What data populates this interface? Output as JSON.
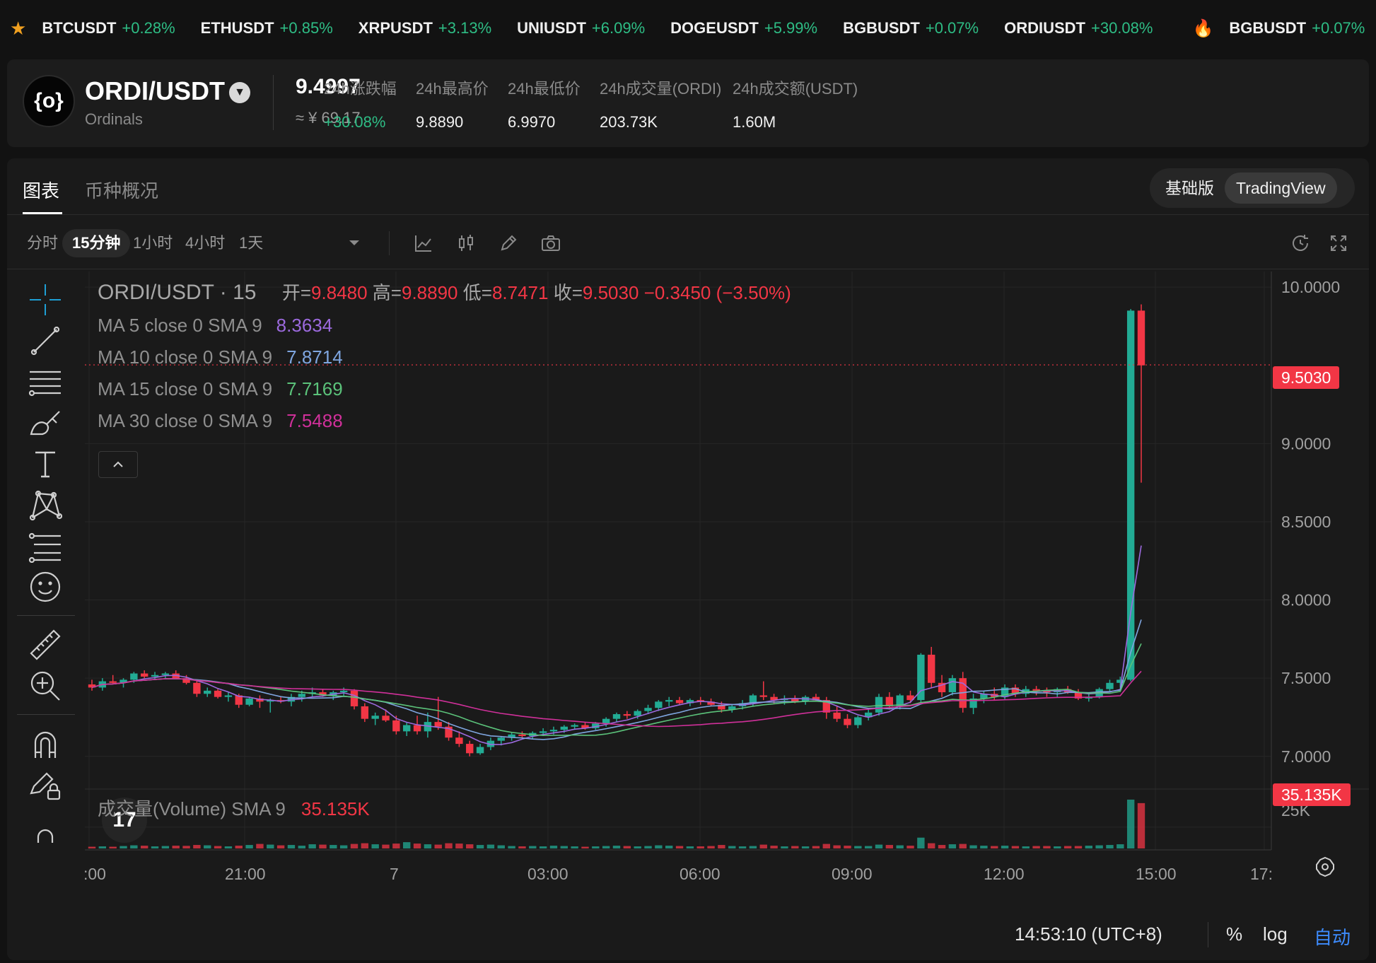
{
  "ticker": {
    "items": [
      {
        "symbol": "BTCUSDT",
        "change": "+0.28%"
      },
      {
        "symbol": "ETHUSDT",
        "change": "+0.85%"
      },
      {
        "symbol": "XRPUSDT",
        "change": "+3.13%"
      },
      {
        "symbol": "UNIUSDT",
        "change": "+6.09%"
      },
      {
        "symbol": "DOGEUSDT",
        "change": "+5.99%"
      },
      {
        "symbol": "BGBUSDT",
        "change": "+0.07%"
      },
      {
        "symbol": "ORDIUSDT",
        "change": "+30.08%"
      }
    ],
    "hot_item": {
      "symbol": "BGBUSDT",
      "change": "+0.07%"
    }
  },
  "header": {
    "logo_glyph": "{o}",
    "pair": "ORDI/USDT",
    "subtitle": "Ordinals",
    "price": "9.4997",
    "price_cny": "≈ ¥ 69.17",
    "stats": [
      {
        "label": "24h涨跌幅",
        "value": "+30.08%",
        "up": true
      },
      {
        "label": "24h最高价",
        "value": "9.8890",
        "up": false
      },
      {
        "label": "24h最低价",
        "value": "6.9970",
        "up": false
      },
      {
        "label": "24h成交量(ORDI)",
        "value": "203.73K",
        "up": false
      },
      {
        "label": "24h成交额(USDT)",
        "value": "1.60M",
        "up": false
      }
    ]
  },
  "tabs": {
    "chart": "图表",
    "overview": "币种概况",
    "basic": "基础版",
    "tradingview": "TradingView"
  },
  "toolbar": {
    "timeframes": [
      "分时",
      "15分钟",
      "1小时",
      "4小时",
      "1天"
    ],
    "selected_timeframe": "15分钟"
  },
  "legend": {
    "symbol": "ORDI/USDT · 15",
    "open_label": "开=",
    "open": "9.8480",
    "high_label": "高=",
    "high": "9.8890",
    "low_label": "低=",
    "low": "8.7471",
    "close_label": "收=",
    "close": "9.5030",
    "change": "−0.3450 (−3.50%)",
    "ma": [
      {
        "label": "MA 5 close 0 SMA 9",
        "value": "8.3634",
        "color": "#9c6ade"
      },
      {
        "label": "MA 10 close 0 SMA 9",
        "value": "7.8714",
        "color": "#7fa6e0"
      },
      {
        "label": "MA 15 close 0 SMA 9",
        "value": "7.7169",
        "color": "#5bc27a"
      },
      {
        "label": "MA 30 close 0 SMA 9",
        "value": "7.5488",
        "color": "#d0309a"
      }
    ],
    "volume_label": "成交量(Volume) SMA 9",
    "volume_value": "35.135K"
  },
  "chart_data": {
    "type": "candlestick",
    "price_axis": {
      "ticks": [
        "10.0000",
        "9.0000",
        "8.5000",
        "8.0000",
        "7.5000",
        "7.0000"
      ],
      "ylim": [
        6.8,
        10.1
      ]
    },
    "time_axis": {
      "ticks": [
        ":00",
        "21:00",
        "7",
        "03:00",
        "06:00",
        "09:00",
        "12:00",
        "15:00",
        "17:"
      ]
    },
    "last_price_label": "9.5030",
    "volume_axis": {
      "ticks": [
        "25K"
      ],
      "last_volume_label": "35.135K"
    },
    "colors": {
      "up": "#22ab94",
      "down": "#f23645",
      "grid": "#262626"
    },
    "candles": [
      [
        7.46,
        7.49,
        7.42,
        7.44
      ],
      [
        7.44,
        7.5,
        7.42,
        7.48
      ],
      [
        7.48,
        7.52,
        7.46,
        7.47
      ],
      [
        7.47,
        7.5,
        7.44,
        7.49
      ],
      [
        7.49,
        7.54,
        7.47,
        7.53
      ],
      [
        7.53,
        7.55,
        7.5,
        7.51
      ],
      [
        7.51,
        7.54,
        7.49,
        7.52
      ],
      [
        7.52,
        7.54,
        7.5,
        7.53
      ],
      [
        7.53,
        7.55,
        7.5,
        7.5
      ],
      [
        7.5,
        7.52,
        7.46,
        7.47
      ],
      [
        7.47,
        7.49,
        7.38,
        7.4
      ],
      [
        7.4,
        7.44,
        7.38,
        7.42
      ],
      [
        7.42,
        7.43,
        7.37,
        7.38
      ],
      [
        7.38,
        7.41,
        7.35,
        7.39
      ],
      [
        7.39,
        7.4,
        7.31,
        7.33
      ],
      [
        7.33,
        7.38,
        7.32,
        7.37
      ],
      [
        7.37,
        7.39,
        7.31,
        7.35
      ],
      [
        7.35,
        7.37,
        7.28,
        7.36
      ],
      [
        7.36,
        7.38,
        7.34,
        7.35
      ],
      [
        7.35,
        7.4,
        7.32,
        7.38
      ],
      [
        7.38,
        7.42,
        7.35,
        7.4
      ],
      [
        7.4,
        7.44,
        7.38,
        7.41
      ],
      [
        7.41,
        7.43,
        7.38,
        7.39
      ],
      [
        7.39,
        7.42,
        7.36,
        7.41
      ],
      [
        7.41,
        7.44,
        7.38,
        7.42
      ],
      [
        7.42,
        7.43,
        7.3,
        7.32
      ],
      [
        7.32,
        7.34,
        7.22,
        7.24
      ],
      [
        7.24,
        7.28,
        7.2,
        7.26
      ],
      [
        7.26,
        7.3,
        7.22,
        7.23
      ],
      [
        7.23,
        7.26,
        7.14,
        7.16
      ],
      [
        7.16,
        7.22,
        7.13,
        7.2
      ],
      [
        7.2,
        7.26,
        7.14,
        7.16
      ],
      [
        7.16,
        7.28,
        7.12,
        7.22
      ],
      [
        7.22,
        7.38,
        7.17,
        7.19
      ],
      [
        7.19,
        7.22,
        7.1,
        7.12
      ],
      [
        7.12,
        7.16,
        7.06,
        7.08
      ],
      [
        7.08,
        7.1,
        7.0,
        7.02
      ],
      [
        7.02,
        7.08,
        7.01,
        7.06
      ],
      [
        7.06,
        7.12,
        7.04,
        7.1
      ],
      [
        7.1,
        7.13,
        7.07,
        7.12
      ],
      [
        7.12,
        7.15,
        7.1,
        7.14
      ],
      [
        7.14,
        7.16,
        7.12,
        7.13
      ],
      [
        7.13,
        7.16,
        7.11,
        7.15
      ],
      [
        7.15,
        7.18,
        7.13,
        7.16
      ],
      [
        7.16,
        7.19,
        7.14,
        7.17
      ],
      [
        7.17,
        7.2,
        7.15,
        7.19
      ],
      [
        7.19,
        7.21,
        7.17,
        7.2
      ],
      [
        7.2,
        7.22,
        7.17,
        7.18
      ],
      [
        7.18,
        7.22,
        7.17,
        7.21
      ],
      [
        7.21,
        7.25,
        7.19,
        7.24
      ],
      [
        7.24,
        7.28,
        7.22,
        7.27
      ],
      [
        7.27,
        7.29,
        7.24,
        7.26
      ],
      [
        7.26,
        7.3,
        7.24,
        7.29
      ],
      [
        7.29,
        7.33,
        7.27,
        7.31
      ],
      [
        7.31,
        7.36,
        7.29,
        7.35
      ],
      [
        7.35,
        7.38,
        7.32,
        7.36
      ],
      [
        7.36,
        7.38,
        7.33,
        7.34
      ],
      [
        7.34,
        7.37,
        7.32,
        7.36
      ],
      [
        7.36,
        7.38,
        7.33,
        7.35
      ],
      [
        7.35,
        7.37,
        7.32,
        7.33
      ],
      [
        7.33,
        7.35,
        7.28,
        7.3
      ],
      [
        7.3,
        7.33,
        7.28,
        7.32
      ],
      [
        7.32,
        7.36,
        7.3,
        7.34
      ],
      [
        7.34,
        7.4,
        7.32,
        7.39
      ],
      [
        7.39,
        7.48,
        7.36,
        7.38
      ],
      [
        7.38,
        7.4,
        7.34,
        7.36
      ],
      [
        7.36,
        7.39,
        7.33,
        7.37
      ],
      [
        7.37,
        7.39,
        7.34,
        7.35
      ],
      [
        7.35,
        7.39,
        7.33,
        7.38
      ],
      [
        7.38,
        7.4,
        7.35,
        7.36
      ],
      [
        7.36,
        7.38,
        7.24,
        7.28
      ],
      [
        7.28,
        7.32,
        7.22,
        7.24
      ],
      [
        7.24,
        7.27,
        7.18,
        7.2
      ],
      [
        7.2,
        7.26,
        7.18,
        7.25
      ],
      [
        7.25,
        7.3,
        7.23,
        7.28
      ],
      [
        7.28,
        7.4,
        7.26,
        7.38
      ],
      [
        7.38,
        7.41,
        7.3,
        7.32
      ],
      [
        7.32,
        7.4,
        7.3,
        7.39
      ],
      [
        7.39,
        7.42,
        7.34,
        7.36
      ],
      [
        7.36,
        7.66,
        7.34,
        7.65
      ],
      [
        7.65,
        7.7,
        7.44,
        7.47
      ],
      [
        7.47,
        7.52,
        7.38,
        7.41
      ],
      [
        7.41,
        7.52,
        7.39,
        7.5
      ],
      [
        7.5,
        7.54,
        7.28,
        7.31
      ],
      [
        7.31,
        7.4,
        7.27,
        7.37
      ],
      [
        7.37,
        7.42,
        7.34,
        7.4
      ],
      [
        7.4,
        7.44,
        7.36,
        7.38
      ],
      [
        7.38,
        7.46,
        7.36,
        7.44
      ],
      [
        7.44,
        7.46,
        7.38,
        7.4
      ],
      [
        7.4,
        7.45,
        7.38,
        7.43
      ],
      [
        7.43,
        7.45,
        7.39,
        7.42
      ],
      [
        7.42,
        7.44,
        7.38,
        7.41
      ],
      [
        7.41,
        7.44,
        7.38,
        7.43
      ],
      [
        7.43,
        7.45,
        7.4,
        7.41
      ],
      [
        7.41,
        7.43,
        7.36,
        7.37
      ],
      [
        7.37,
        7.4,
        7.35,
        7.38
      ],
      [
        7.38,
        7.44,
        7.37,
        7.43
      ],
      [
        7.43,
        7.49,
        7.41,
        7.47
      ],
      [
        7.47,
        7.51,
        7.44,
        7.49
      ],
      [
        7.49,
        9.86,
        7.48,
        9.85
      ],
      [
        9.85,
        9.89,
        8.75,
        9.5
      ]
    ],
    "volumes": [
      0.1,
      0.12,
      0.1,
      0.14,
      0.18,
      0.16,
      0.12,
      0.14,
      0.16,
      0.15,
      0.2,
      0.18,
      0.14,
      0.12,
      0.16,
      0.2,
      0.26,
      0.22,
      0.18,
      0.2,
      0.16,
      0.24,
      0.22,
      0.2,
      0.18,
      0.26,
      0.3,
      0.24,
      0.22,
      0.28,
      0.36,
      0.28,
      0.24,
      0.22,
      0.3,
      0.28,
      0.24,
      0.2,
      0.22,
      0.18,
      0.14,
      0.12,
      0.14,
      0.12,
      0.16,
      0.14,
      0.12,
      0.1,
      0.12,
      0.14,
      0.16,
      0.14,
      0.12,
      0.14,
      0.18,
      0.16,
      0.14,
      0.12,
      0.12,
      0.14,
      0.2,
      0.14,
      0.12,
      0.14,
      0.22,
      0.16,
      0.12,
      0.14,
      0.12,
      0.14,
      0.26,
      0.18,
      0.16,
      0.14,
      0.14,
      0.22,
      0.2,
      0.18,
      0.16,
      0.62,
      0.3,
      0.2,
      0.24,
      0.26,
      0.18,
      0.16,
      0.14,
      0.16,
      0.14,
      0.12,
      0.14,
      0.14,
      0.12,
      0.14,
      0.14,
      0.16,
      0.18,
      0.2,
      0.24,
      2.8,
      2.6
    ]
  },
  "bottom": {
    "time": "14:53:10 (UTC+8)",
    "percent": "%",
    "log": "log",
    "auto": "自动"
  }
}
